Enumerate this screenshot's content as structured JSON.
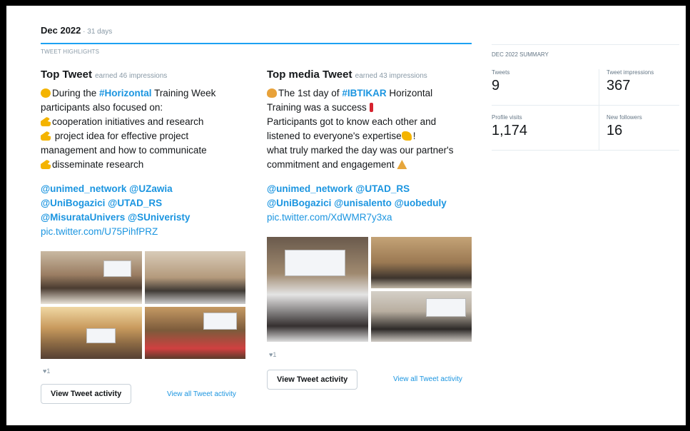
{
  "header": {
    "month": "Dec 2022",
    "days": " · 31 days"
  },
  "highlights_label": "TWEET HIGHLIGHTS",
  "top_tweet": {
    "title": "Top Tweet",
    "earned": "earned 46 impressions",
    "lines": [
      {
        "parts": [
          [
            "emoji",
            "face"
          ],
          [
            "text",
            "During the "
          ],
          [
            "hashtag",
            "#Horizontal"
          ],
          [
            "text",
            " Training Week"
          ]
        ]
      },
      {
        "parts": [
          [
            "text",
            "participants also focused on:"
          ]
        ]
      },
      {
        "parts": [
          [
            "emoji",
            "hand"
          ],
          [
            "text",
            "cooperation initiatives and research"
          ]
        ]
      },
      {
        "parts": [
          [
            "emoji",
            "hand"
          ],
          [
            "text",
            " project idea for effective project"
          ]
        ]
      },
      {
        "parts": [
          [
            "text",
            "management and how to communicate"
          ]
        ]
      },
      {
        "parts": [
          [
            "emoji",
            "hand"
          ],
          [
            "text",
            "disseminate research"
          ]
        ]
      }
    ],
    "mentions": [
      "@unimed_network @UZawia",
      "@UniBogazici @UTAD_RS",
      "@MisurataUnivers @SUniveristy"
    ],
    "pic_link": "pic.twitter.com/U75PihfPRZ",
    "likes": "♥1",
    "button": "View Tweet activity",
    "view_all": "View all Tweet activity"
  },
  "top_media_tweet": {
    "title": "Top media Tweet",
    "earned": "earned 43 impressions",
    "lines": [
      {
        "parts": [
          [
            "emoji",
            "clap"
          ],
          [
            "text",
            "The 1st day of "
          ],
          [
            "hashtag",
            "#IBTIKAR"
          ],
          [
            "text",
            " Horizontal"
          ]
        ]
      },
      {
        "parts": [
          [
            "text",
            "Training was a success "
          ],
          [
            "emoji",
            "excl"
          ]
        ]
      },
      {
        "parts": [
          [
            "text",
            "Participants got to know each other and"
          ]
        ]
      },
      {
        "parts": [
          [
            "text",
            "listened to everyone's expertise"
          ],
          [
            "emoji",
            "muscle"
          ],
          [
            "text",
            "!"
          ]
        ]
      },
      {
        "parts": [
          [
            "text",
            "what truly marked the day was our partner's"
          ]
        ]
      },
      {
        "parts": [
          [
            "text",
            "commitment and engagement "
          ],
          [
            "emoji",
            "pray"
          ]
        ]
      }
    ],
    "mentions": [
      "@unimed_network @UTAD_RS",
      "@UniBogazici @unisalento @uobeduly"
    ],
    "pic_link": "pic.twitter.com/XdWMR7y3xa",
    "likes": "♥1",
    "button": "View Tweet activity",
    "view_all": "View all Tweet activity"
  },
  "summary": {
    "label": "DEC 2022 SUMMARY",
    "tweets_label": "Tweets",
    "tweets": "9",
    "impressions_label": "Tweet impressions",
    "impressions": "367",
    "profile_label": "Profile visits",
    "profile": "1,174",
    "followers_label": "New followers",
    "followers": "16"
  }
}
